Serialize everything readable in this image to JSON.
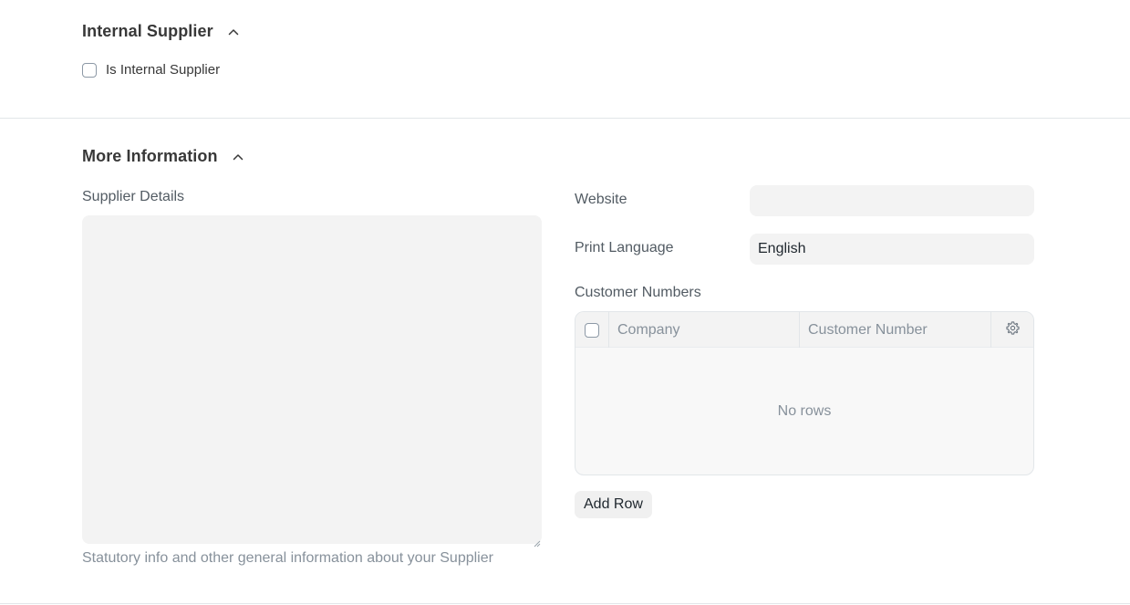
{
  "internal_supplier": {
    "title": "Internal Supplier",
    "is_internal_supplier_label": "Is Internal Supplier",
    "is_internal_supplier_checked": false
  },
  "more_information": {
    "title": "More Information",
    "supplier_details": {
      "label": "Supplier Details",
      "value": "",
      "help": "Statutory info and other general information about your Supplier"
    },
    "website": {
      "label": "Website",
      "value": ""
    },
    "print_language": {
      "label": "Print Language",
      "value": "English"
    },
    "customer_numbers": {
      "label": "Customer Numbers",
      "columns": [
        "Company",
        "Customer Number"
      ],
      "rows": [],
      "empty_text": "No rows",
      "add_row_label": "Add Row"
    }
  },
  "icons": {
    "collapse": "chevron-up-icon",
    "settings": "gear-icon"
  }
}
